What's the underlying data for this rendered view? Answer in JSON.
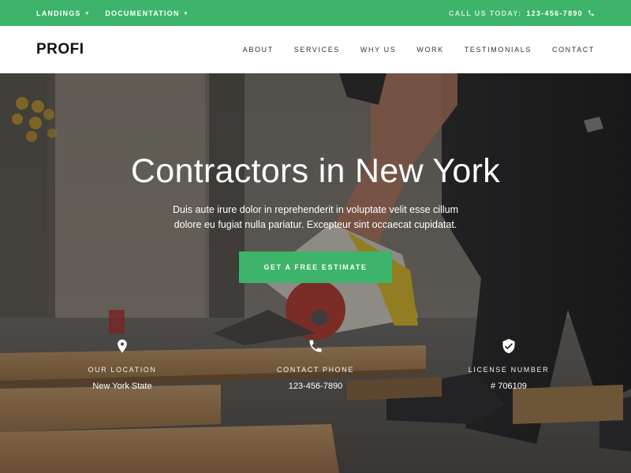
{
  "topbar": {
    "links": [
      {
        "label": "LANDINGS"
      },
      {
        "label": "DOCUMENTATION"
      }
    ],
    "call_label": "CALL US TODAY:",
    "phone": "123-456-7890"
  },
  "header": {
    "logo": "PROFI",
    "nav": [
      "ABOUT",
      "SERVICES",
      "WHY US",
      "WORK",
      "TESTIMONIALS",
      "CONTACT"
    ]
  },
  "hero": {
    "title": "Contractors in New York",
    "text": "Duis aute irure dolor in reprehenderit in voluptate velit esse cillum dolore eu fugiat nulla pariatur. Excepteur sint occaecat cupidatat.",
    "cta_label": "GET A FREE ESTIMATE"
  },
  "features": [
    {
      "icon": "map-pin-icon",
      "label": "OUR LOCATION",
      "value": "New York State"
    },
    {
      "icon": "phone-icon",
      "label": "CONTACT PHONE",
      "value": "123-456-7890"
    },
    {
      "icon": "shield-check-icon",
      "label": "LICENSE NUMBER",
      "value": "# 706109"
    }
  ],
  "colors": {
    "accent": "#3db46a"
  }
}
